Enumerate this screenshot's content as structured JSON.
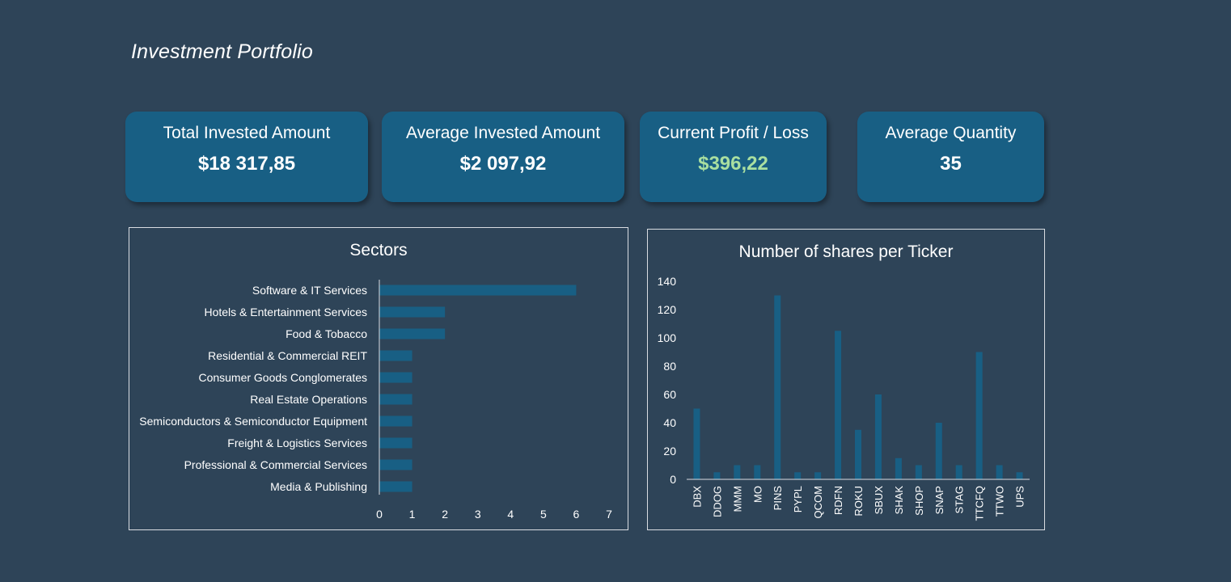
{
  "page_title": "Investment Portfolio",
  "colors": {
    "background": "#2e4458",
    "card": "#185f84",
    "bar": "#185f84",
    "profit_positive": "#a9dfa0",
    "text": "#ffffff"
  },
  "kpis": {
    "total_invested": {
      "label": "Total Invested Amount",
      "value": "$18 317,85"
    },
    "average_invested": {
      "label": "Average Invested Amount",
      "value": "$2 097,92"
    },
    "profit_loss": {
      "label": "Current Profit / Loss",
      "value": "$396,22"
    },
    "average_quantity": {
      "label": "Average Quantity",
      "value": "35"
    }
  },
  "chart_data": [
    {
      "type": "bar",
      "orientation": "horizontal",
      "title": "Sectors",
      "categories": [
        "Software & IT Services",
        "Hotels & Entertainment Services",
        "Food & Tobacco",
        "Residential & Commercial REIT",
        "Consumer Goods Conglomerates",
        "Real Estate Operations",
        "Semiconductors & Semiconductor Equipment",
        "Freight & Logistics Services",
        "Professional & Commercial Services",
        "Media & Publishing"
      ],
      "values": [
        6,
        2,
        2,
        1,
        1,
        1,
        1,
        1,
        1,
        1
      ],
      "xlim": [
        0,
        7
      ],
      "xticks": [
        0,
        1,
        2,
        3,
        4,
        5,
        6,
        7
      ],
      "grid": false
    },
    {
      "type": "bar",
      "orientation": "vertical",
      "title": "Number of shares per Ticker",
      "categories": [
        "DBX",
        "DDOG",
        "MMM",
        "MO",
        "PINS",
        "PYPL",
        "QCOM",
        "RDFN",
        "ROKU",
        "SBUX",
        "SHAK",
        "SHOP",
        "SNAP",
        "STAG",
        "TTCFQ",
        "TTWO",
        "UPS"
      ],
      "values": [
        50,
        5,
        10,
        10,
        130,
        5,
        5,
        105,
        35,
        60,
        15,
        10,
        40,
        10,
        90,
        10,
        5
      ],
      "ylim": [
        0,
        140
      ],
      "yticks": [
        0,
        20,
        40,
        60,
        80,
        100,
        120,
        140
      ],
      "grid": false
    }
  ]
}
